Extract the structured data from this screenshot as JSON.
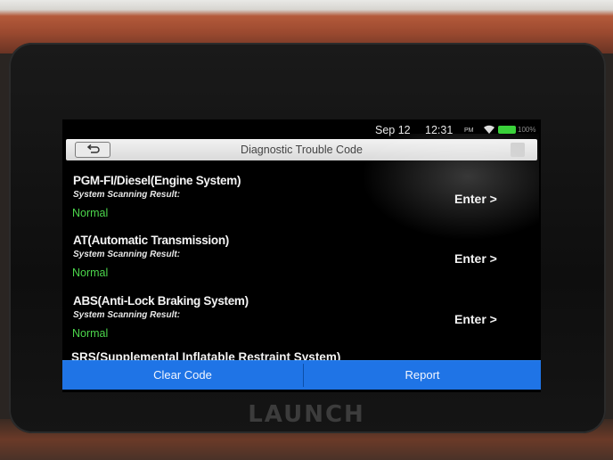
{
  "brand": "LAUNCH",
  "status": {
    "date": "Sep 12",
    "time": "12:31",
    "ampm": "PM",
    "battery": "100%"
  },
  "header": {
    "title": "Diagnostic Trouble Code"
  },
  "systems": [
    {
      "name": "PGM-FI/Diesel(Engine System)",
      "label": "System Scanning Result:",
      "result": "Normal",
      "action": "Enter >"
    },
    {
      "name": "AT(Automatic Transmission)",
      "label": "System Scanning Result:",
      "result": "Normal",
      "action": "Enter >"
    },
    {
      "name": "ABS(Anti-Lock Braking System)",
      "label": "System Scanning Result:",
      "result": "Normal",
      "action": "Enter >"
    }
  ],
  "partial_item": "SRS(Supplemental Inflatable Restraint System)",
  "footer": {
    "clear_label": "Clear Code",
    "report_label": "Report"
  },
  "colors": {
    "accent": "#1f74e6",
    "result_ok": "#4cd64c",
    "battery": "#3ad13a"
  }
}
